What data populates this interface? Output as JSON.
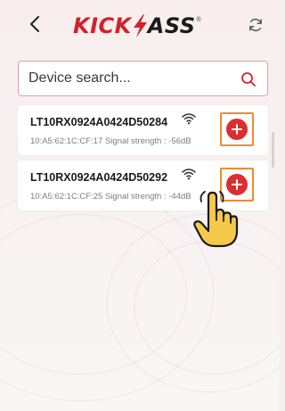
{
  "header": {
    "brand": "KICKASS",
    "brand_part1": "KICK",
    "brand_part2": "ASS",
    "back_icon": "chevron-left-icon",
    "refresh_icon": "refresh-icon"
  },
  "search": {
    "placeholder": "Device search...",
    "value": "",
    "icon": "search-icon"
  },
  "devices": [
    {
      "name": "LT10RX0924A0424D50284",
      "mac": "10:A5:62:1C:CF:17",
      "signal_label": "Signal strength :",
      "signal_value": "-56dB",
      "detail": "10:A5:62:1C:CF:17 Signal strength : -56dB",
      "icon": "wifi-icon",
      "action_icon": "add-icon"
    },
    {
      "name": "LT10RX0924A0424D50292",
      "mac": "10:A5:62:1C:CF:25",
      "signal_label": "Signal strength :",
      "signal_value": "-44dB",
      "detail": "10:A5:62:1C:CF:25 Signal strength : -44dB",
      "icon": "wifi-icon",
      "action_icon": "add-icon"
    }
  ],
  "colors": {
    "brand_red": "#d0232a",
    "brand_dark": "#1a1a1a",
    "accent_red": "#dc2e31",
    "highlight_orange": "#ef8b34",
    "search_border": "#e1a0a2",
    "background": "#f6efef",
    "hand_fill": "#f7c94b"
  },
  "pointer": {
    "icon": "pointing-hand-icon"
  }
}
